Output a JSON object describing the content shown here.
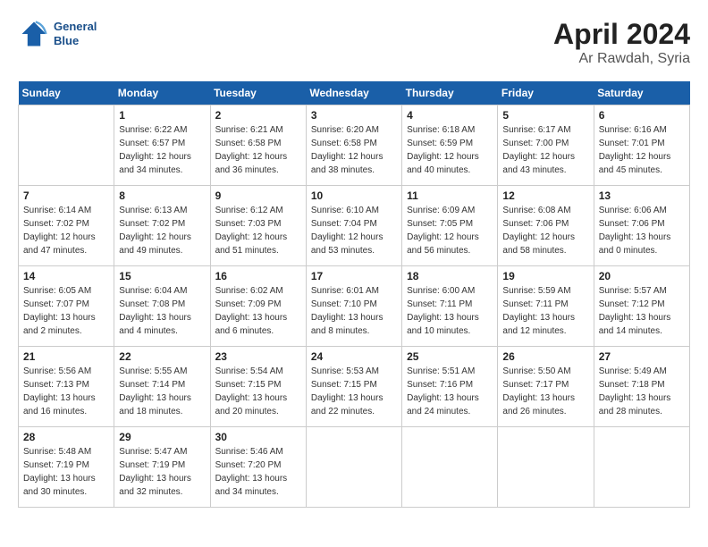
{
  "header": {
    "logo_line1": "General",
    "logo_line2": "Blue",
    "month": "April 2024",
    "location": "Ar Rawdah, Syria"
  },
  "days_of_week": [
    "Sunday",
    "Monday",
    "Tuesday",
    "Wednesday",
    "Thursday",
    "Friday",
    "Saturday"
  ],
  "weeks": [
    [
      {
        "day": "",
        "empty": true
      },
      {
        "day": "1",
        "sunrise": "6:22 AM",
        "sunset": "6:57 PM",
        "daylight": "12 hours and 34 minutes."
      },
      {
        "day": "2",
        "sunrise": "6:21 AM",
        "sunset": "6:58 PM",
        "daylight": "12 hours and 36 minutes."
      },
      {
        "day": "3",
        "sunrise": "6:20 AM",
        "sunset": "6:58 PM",
        "daylight": "12 hours and 38 minutes."
      },
      {
        "day": "4",
        "sunrise": "6:18 AM",
        "sunset": "6:59 PM",
        "daylight": "12 hours and 40 minutes."
      },
      {
        "day": "5",
        "sunrise": "6:17 AM",
        "sunset": "7:00 PM",
        "daylight": "12 hours and 43 minutes."
      },
      {
        "day": "6",
        "sunrise": "6:16 AM",
        "sunset": "7:01 PM",
        "daylight": "12 hours and 45 minutes."
      }
    ],
    [
      {
        "day": "7",
        "sunrise": "6:14 AM",
        "sunset": "7:02 PM",
        "daylight": "12 hours and 47 minutes."
      },
      {
        "day": "8",
        "sunrise": "6:13 AM",
        "sunset": "7:02 PM",
        "daylight": "12 hours and 49 minutes."
      },
      {
        "day": "9",
        "sunrise": "6:12 AM",
        "sunset": "7:03 PM",
        "daylight": "12 hours and 51 minutes."
      },
      {
        "day": "10",
        "sunrise": "6:10 AM",
        "sunset": "7:04 PM",
        "daylight": "12 hours and 53 minutes."
      },
      {
        "day": "11",
        "sunrise": "6:09 AM",
        "sunset": "7:05 PM",
        "daylight": "12 hours and 56 minutes."
      },
      {
        "day": "12",
        "sunrise": "6:08 AM",
        "sunset": "7:06 PM",
        "daylight": "12 hours and 58 minutes."
      },
      {
        "day": "13",
        "sunrise": "6:06 AM",
        "sunset": "7:06 PM",
        "daylight": "13 hours and 0 minutes."
      }
    ],
    [
      {
        "day": "14",
        "sunrise": "6:05 AM",
        "sunset": "7:07 PM",
        "daylight": "13 hours and 2 minutes."
      },
      {
        "day": "15",
        "sunrise": "6:04 AM",
        "sunset": "7:08 PM",
        "daylight": "13 hours and 4 minutes."
      },
      {
        "day": "16",
        "sunrise": "6:02 AM",
        "sunset": "7:09 PM",
        "daylight": "13 hours and 6 minutes."
      },
      {
        "day": "17",
        "sunrise": "6:01 AM",
        "sunset": "7:10 PM",
        "daylight": "13 hours and 8 minutes."
      },
      {
        "day": "18",
        "sunrise": "6:00 AM",
        "sunset": "7:11 PM",
        "daylight": "13 hours and 10 minutes."
      },
      {
        "day": "19",
        "sunrise": "5:59 AM",
        "sunset": "7:11 PM",
        "daylight": "13 hours and 12 minutes."
      },
      {
        "day": "20",
        "sunrise": "5:57 AM",
        "sunset": "7:12 PM",
        "daylight": "13 hours and 14 minutes."
      }
    ],
    [
      {
        "day": "21",
        "sunrise": "5:56 AM",
        "sunset": "7:13 PM",
        "daylight": "13 hours and 16 minutes."
      },
      {
        "day": "22",
        "sunrise": "5:55 AM",
        "sunset": "7:14 PM",
        "daylight": "13 hours and 18 minutes."
      },
      {
        "day": "23",
        "sunrise": "5:54 AM",
        "sunset": "7:15 PM",
        "daylight": "13 hours and 20 minutes."
      },
      {
        "day": "24",
        "sunrise": "5:53 AM",
        "sunset": "7:15 PM",
        "daylight": "13 hours and 22 minutes."
      },
      {
        "day": "25",
        "sunrise": "5:51 AM",
        "sunset": "7:16 PM",
        "daylight": "13 hours and 24 minutes."
      },
      {
        "day": "26",
        "sunrise": "5:50 AM",
        "sunset": "7:17 PM",
        "daylight": "13 hours and 26 minutes."
      },
      {
        "day": "27",
        "sunrise": "5:49 AM",
        "sunset": "7:18 PM",
        "daylight": "13 hours and 28 minutes."
      }
    ],
    [
      {
        "day": "28",
        "sunrise": "5:48 AM",
        "sunset": "7:19 PM",
        "daylight": "13 hours and 30 minutes."
      },
      {
        "day": "29",
        "sunrise": "5:47 AM",
        "sunset": "7:19 PM",
        "daylight": "13 hours and 32 minutes."
      },
      {
        "day": "30",
        "sunrise": "5:46 AM",
        "sunset": "7:20 PM",
        "daylight": "13 hours and 34 minutes."
      },
      {
        "day": "",
        "empty": true
      },
      {
        "day": "",
        "empty": true
      },
      {
        "day": "",
        "empty": true
      },
      {
        "day": "",
        "empty": true
      }
    ]
  ],
  "labels": {
    "sunrise_prefix": "Sunrise: ",
    "sunset_prefix": "Sunset: ",
    "daylight_prefix": "Daylight: "
  }
}
